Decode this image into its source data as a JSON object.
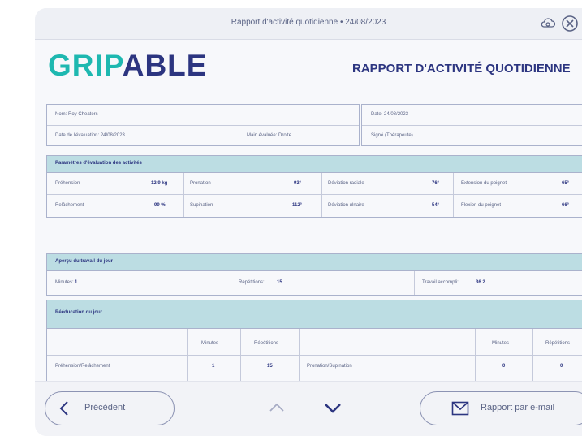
{
  "window": {
    "title": "Rapport d'activité quotidienne • 24/08/2023"
  },
  "icons": {
    "cloud": "cloud-icon",
    "close": "close-circle-icon",
    "back": "chevron-left-icon",
    "up": "chevron-up-icon",
    "down": "chevron-down-icon",
    "mail": "mail-icon"
  },
  "logo": {
    "part1": "GRIP",
    "part2": "ABLE"
  },
  "report": {
    "title": "RAPPORT D'ACTIVITÉ QUOTIDIENNE"
  },
  "info": {
    "name": "Nom: Roy Cheaters",
    "eval_date": "Date de l'évaluation: 24/08/2023",
    "hand": "Main évaluée: Droite",
    "date": "Date: 24/08/2023",
    "signed": "Signé (Thérapeute)"
  },
  "params": {
    "heading": "Paramètres d'évaluation des activités",
    "rows": [
      [
        {
          "label": "Préhension",
          "value": "12.9 kg"
        },
        {
          "label": "Pronation",
          "value": "93°"
        },
        {
          "label": "Déviation radiale",
          "value": "76°"
        },
        {
          "label": "Extension du poignet",
          "value": "65°"
        }
      ],
      [
        {
          "label": "Relâchement",
          "value": "99 %"
        },
        {
          "label": "Supination",
          "value": "112°"
        },
        {
          "label": "Déviation ulnaire",
          "value": "54°"
        },
        {
          "label": "Flexion du poignet",
          "value": "66°"
        }
      ]
    ]
  },
  "overview": {
    "heading": "Aperçu du travail du jour",
    "minutes_label": "Minutes:",
    "minutes_value": "1",
    "reps_label": "Répétitions:",
    "reps_value": "15",
    "work_label": "Travail accompli:",
    "work_value": "36.2"
  },
  "rehab": {
    "heading": "Rééducation du jour",
    "col_minutes": "Minutes",
    "col_reps": "Répétitions",
    "col_minutes_r": "Minutes",
    "col_reps_r": "Répétitions",
    "row_label": "Préhension/Relâchement",
    "row_minutes": "1",
    "row_reps": "15",
    "row_label_r": "Pronation/Supination",
    "row_minutes_r": "0",
    "row_reps_r": "0"
  },
  "footer": {
    "prev": "Précédent",
    "email": "Rapport par e-mail"
  }
}
